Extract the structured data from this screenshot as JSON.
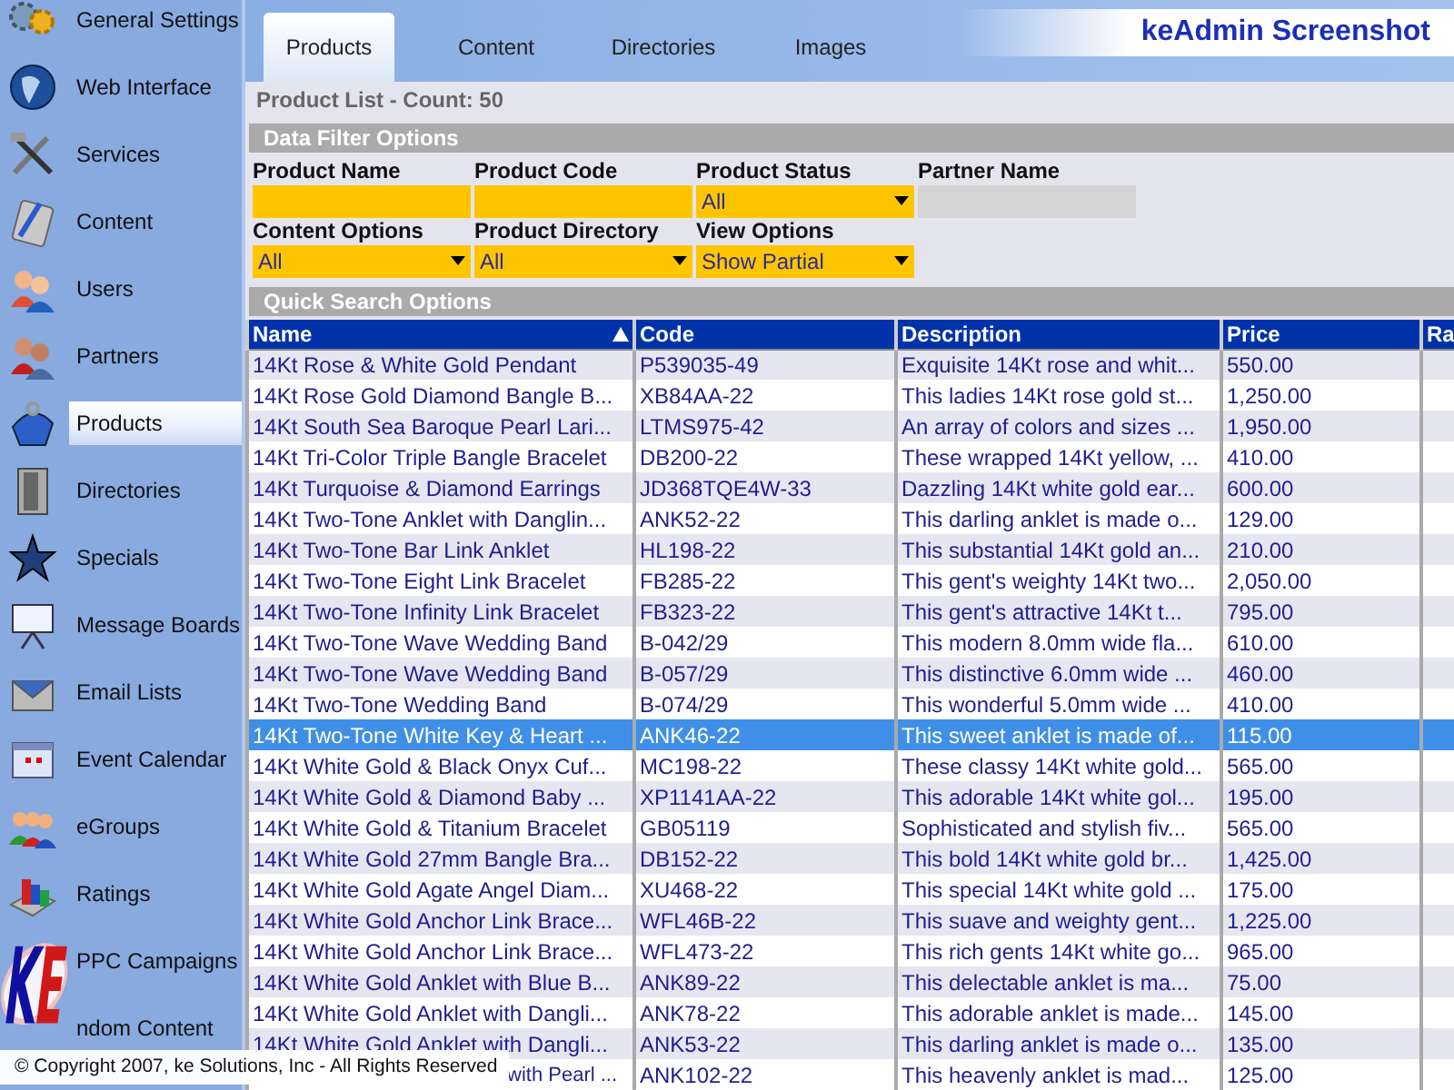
{
  "sidebar": {
    "items": [
      {
        "label": "General Settings",
        "selected": false
      },
      {
        "label": "Web Interface",
        "selected": false
      },
      {
        "label": "Services",
        "selected": false
      },
      {
        "label": "Content",
        "selected": false
      },
      {
        "label": "Users",
        "selected": false
      },
      {
        "label": "Partners",
        "selected": false
      },
      {
        "label": "Products",
        "selected": true
      },
      {
        "label": "Directories",
        "selected": false
      },
      {
        "label": "Specials",
        "selected": false
      },
      {
        "label": "Message Boards",
        "selected": false
      },
      {
        "label": "Email Lists",
        "selected": false
      },
      {
        "label": "Event Calendar",
        "selected": false
      },
      {
        "label": "eGroups",
        "selected": false
      },
      {
        "label": "Ratings",
        "selected": false
      },
      {
        "label": "PPC Campaigns",
        "selected": false
      },
      {
        "label": "ndom Content",
        "selected": false
      }
    ]
  },
  "tabs": [
    {
      "label": "Products",
      "selected": true
    },
    {
      "label": "Content",
      "selected": false
    },
    {
      "label": "Directories",
      "selected": false
    },
    {
      "label": "Images",
      "selected": false
    }
  ],
  "brand": "keAdmin Screenshot",
  "list_title": "Product List - Count: 50",
  "filter_section": "Data Filter Options",
  "filters": [
    {
      "label": "Product Name",
      "kind": "text"
    },
    {
      "label": "Product Code",
      "kind": "text"
    },
    {
      "label": "Product Status",
      "kind": "select",
      "value": "All"
    },
    {
      "label": "Partner Name",
      "kind": "lookup"
    },
    {
      "label": "Content Options",
      "kind": "select",
      "value": "All"
    },
    {
      "label": "Product Directory",
      "kind": "select",
      "value": "All"
    },
    {
      "label": "View Options",
      "kind": "select",
      "value": "Show Partial"
    }
  ],
  "quick_search": "Quick Search Options",
  "table": {
    "columns": [
      {
        "label": "Name",
        "sorted": true
      },
      {
        "label": "Code",
        "sorted": false
      },
      {
        "label": "Description",
        "sorted": false
      },
      {
        "label": "Price",
        "sorted": false
      },
      {
        "label": "Ra",
        "sorted": false
      }
    ],
    "rows": [
      {
        "cells": [
          "14Kt Rose & White Gold Pendant",
          "P539035-49",
          "Exquisite 14Kt rose and whit...",
          "550.00"
        ],
        "selected": false,
        "covered": false
      },
      {
        "cells": [
          "14Kt Rose Gold Diamond Bangle B...",
          "XB84AA-22",
          "This ladies 14Kt rose gold st...",
          "1,250.00"
        ],
        "selected": false,
        "covered": false
      },
      {
        "cells": [
          "14Kt South Sea Baroque Pearl Lari...",
          "LTMS975-42",
          "An array of colors and sizes ...",
          "1,950.00"
        ],
        "selected": false,
        "covered": false
      },
      {
        "cells": [
          "14Kt Tri-Color Triple Bangle Bracelet",
          "DB200-22",
          "These wrapped 14Kt yellow, ...",
          "410.00"
        ],
        "selected": false,
        "covered": false
      },
      {
        "cells": [
          "14Kt Turquoise & Diamond Earrings",
          "JD368TQE4W-33",
          "Dazzling 14Kt white gold ear...",
          "600.00"
        ],
        "selected": false,
        "covered": false
      },
      {
        "cells": [
          "14Kt Two-Tone Anklet with Danglin...",
          "ANK52-22",
          "This darling anklet is made o...",
          "129.00"
        ],
        "selected": false,
        "covered": false
      },
      {
        "cells": [
          "14Kt Two-Tone Bar Link Anklet",
          "HL198-22",
          "This substantial 14Kt gold an...",
          "210.00"
        ],
        "selected": false,
        "covered": false
      },
      {
        "cells": [
          "14Kt Two-Tone Eight Link Bracelet",
          "FB285-22",
          "This gent's weighty 14Kt two...",
          "2,050.00"
        ],
        "selected": false,
        "covered": false
      },
      {
        "cells": [
          "14Kt Two-Tone Infinity Link Bracelet",
          "FB323-22",
          "This gent's attractive 14Kt t...",
          "795.00"
        ],
        "selected": false,
        "covered": false
      },
      {
        "cells": [
          "14Kt Two-Tone Wave Wedding Band",
          "B-042/29",
          "This modern 8.0mm wide fla...",
          "610.00"
        ],
        "selected": false,
        "covered": false
      },
      {
        "cells": [
          "14Kt Two-Tone Wave Wedding Band",
          "B-057/29",
          "This distinctive 6.0mm wide ...",
          "460.00"
        ],
        "selected": false,
        "covered": false
      },
      {
        "cells": [
          "14Kt Two-Tone Wedding Band",
          "B-074/29",
          "This wonderful 5.0mm wide ...",
          "410.00"
        ],
        "selected": false,
        "covered": false
      },
      {
        "cells": [
          "14Kt Two-Tone White Key & Heart ...",
          "ANK46-22",
          "This sweet anklet is made of...",
          "115.00"
        ],
        "selected": true,
        "covered": false
      },
      {
        "cells": [
          "14Kt White Gold & Black Onyx Cuf...",
          "MC198-22",
          "These classy 14Kt white gold...",
          "565.00"
        ],
        "selected": false,
        "covered": false
      },
      {
        "cells": [
          "14Kt White Gold & Diamond Baby ...",
          "XP1141AA-22",
          "This adorable 14Kt white gol...",
          "195.00"
        ],
        "selected": false,
        "covered": false
      },
      {
        "cells": [
          "14Kt White Gold & Titanium Bracelet",
          "GB05119",
          "Sophisticated and stylish fiv...",
          "565.00"
        ],
        "selected": false,
        "covered": false
      },
      {
        "cells": [
          "14Kt White Gold 27mm Bangle Bra...",
          "DB152-22",
          "This bold 14Kt white gold br...",
          "1,425.00"
        ],
        "selected": false,
        "covered": false
      },
      {
        "cells": [
          "14Kt White Gold Agate Angel Diam...",
          "XU468-22",
          "This special 14Kt white gold ...",
          "175.00"
        ],
        "selected": false,
        "covered": false
      },
      {
        "cells": [
          "14Kt White Gold Anchor Link Brace...",
          "WFL46B-22",
          "This suave and weighty gent...",
          "1,225.00"
        ],
        "selected": false,
        "covered": false
      },
      {
        "cells": [
          "14Kt White Gold Anchor Link Brace...",
          "WFL473-22",
          "This rich gents 14Kt white go...",
          "965.00"
        ],
        "selected": false,
        "covered": false
      },
      {
        "cells": [
          "14Kt White Gold Anklet with Blue B...",
          "ANK89-22",
          "This delectable anklet is ma...",
          "75.00"
        ],
        "selected": false,
        "covered": false
      },
      {
        "cells": [
          "14Kt White Gold Anklet with Dangli...",
          "ANK78-22",
          "This adorable anklet is made...",
          "145.00"
        ],
        "selected": false,
        "covered": false
      },
      {
        "cells": [
          "14Kt White Gold Anklet with Dangli...",
          "ANK53-22",
          "This darling anklet is made o...",
          "135.00"
        ],
        "selected": false,
        "covered": false
      },
      {
        "cells": [
          "with Pearl ...",
          "ANK102-22",
          "This heavenly anklet is mad...",
          "125.00"
        ],
        "selected": false,
        "covered": true
      }
    ]
  },
  "footer": "© Copyright 2007, ke Solutions, Inc - All Rights Reserved"
}
